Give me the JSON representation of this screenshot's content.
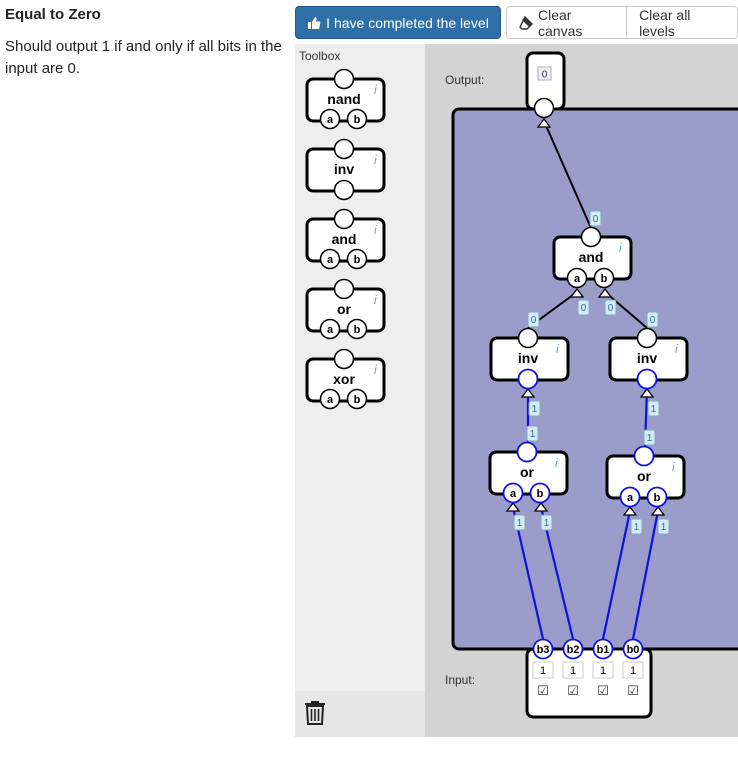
{
  "level": {
    "title": "Equal to Zero",
    "description": "Should output 1 if and only if all bits in the input are 0."
  },
  "toolbar": {
    "complete_label": "I have completed the level",
    "clear_canvas_label": "Clear canvas",
    "clear_levels_label": "Clear all levels"
  },
  "toolbox": {
    "title": "Toolbox",
    "info_glyph": "i",
    "gates": [
      {
        "name": "nand",
        "inputs": [
          "a",
          "b"
        ]
      },
      {
        "name": "inv",
        "inputs": []
      },
      {
        "name": "and",
        "inputs": [
          "a",
          "b"
        ]
      },
      {
        "name": "or",
        "inputs": [
          "a",
          "b"
        ]
      },
      {
        "name": "xor",
        "inputs": [
          "a",
          "b"
        ]
      }
    ]
  },
  "canvas": {
    "output_label": "Output:",
    "input_label": "Input:",
    "output_value": "0",
    "inputs": [
      {
        "name": "b3",
        "value": "1",
        "checked": true
      },
      {
        "name": "b2",
        "value": "1",
        "checked": true
      },
      {
        "name": "b1",
        "value": "1",
        "checked": true
      },
      {
        "name": "b0",
        "value": "1",
        "checked": true
      }
    ],
    "gates": {
      "and_top": {
        "name": "and",
        "inputs": [
          "a",
          "b"
        ]
      },
      "inv_left": {
        "name": "inv"
      },
      "inv_right": {
        "name": "inv"
      },
      "or_left": {
        "name": "or",
        "inputs": [
          "a",
          "b"
        ]
      },
      "or_right": {
        "name": "or",
        "inputs": [
          "a",
          "b"
        ]
      }
    },
    "wire_values": {
      "and_to_output": "0",
      "inv_left_to_and_a": [
        "0",
        "0"
      ],
      "inv_right_to_and_b": [
        "0",
        "0"
      ],
      "or_left_to_inv_left": [
        "1",
        "1"
      ],
      "or_right_to_inv_right": [
        "1",
        "1"
      ],
      "b3_to_or_left_a": "1",
      "b2_to_or_left_b": "1",
      "b1_to_or_right_a": "1",
      "b0_to_or_right_b": "1"
    },
    "colors": {
      "high_wire": "#1111dd",
      "low_wire": "#000000",
      "group_fill": "#9a9cc9",
      "canvas_bg": "#d3d3d3"
    }
  }
}
